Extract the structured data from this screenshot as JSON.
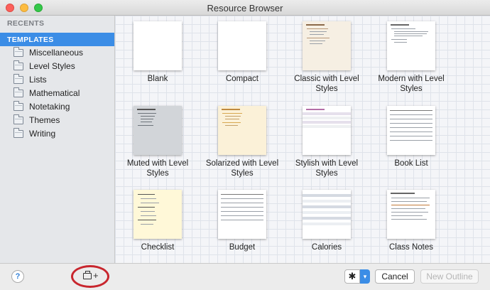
{
  "window": {
    "title": "Resource Browser"
  },
  "sidebar": {
    "recents_label": "RECENTS",
    "templates_label": "TEMPLATES",
    "items": [
      {
        "label": "Miscellaneous"
      },
      {
        "label": "Level Styles"
      },
      {
        "label": "Lists"
      },
      {
        "label": "Mathematical"
      },
      {
        "label": "Notetaking"
      },
      {
        "label": "Themes"
      },
      {
        "label": "Writing"
      }
    ]
  },
  "templates": [
    {
      "name": "Blank"
    },
    {
      "name": "Compact"
    },
    {
      "name": "Classic with Level Styles"
    },
    {
      "name": "Modern with Level Styles"
    },
    {
      "name": "Muted with Level Styles"
    },
    {
      "name": "Solarized with Level Styles"
    },
    {
      "name": "Stylish with Level Styles"
    },
    {
      "name": "Book List"
    },
    {
      "name": "Checklist"
    },
    {
      "name": "Budget"
    },
    {
      "name": "Calories"
    },
    {
      "name": "Class Notes"
    }
  ],
  "footer": {
    "help_label": "?",
    "add_icon": "camera-plus-icon",
    "add_plus": "+",
    "gear_glyph": "✱",
    "dropdown_glyph": "▾",
    "cancel_label": "Cancel",
    "new_outline_label": "New Outline"
  },
  "colors": {
    "selection": "#3b8de6",
    "highlight_circle": "#c8262e"
  }
}
